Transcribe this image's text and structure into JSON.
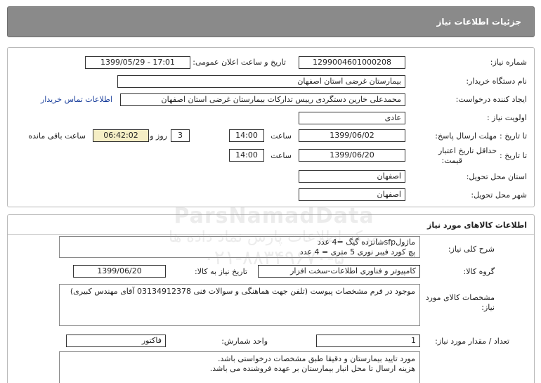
{
  "header": {
    "title": "جزئیات اطلاعات نیاز"
  },
  "info": {
    "need_number_label": "شماره نیاز:",
    "need_number_value": "1299004601000208",
    "announce_label": "تاریخ و ساعت اعلان عمومی:",
    "announce_value": "1399/05/29 - 17:01",
    "buyer_label": "نام دستگاه خریدار:",
    "buyer_value": "بیمارستان غرضی استان اصفهان",
    "requester_label": "ایجاد کننده درخواست:",
    "requester_value": "محمدعلی خارین دستگردی رییس تدارکات بیمارستان غرضی استان اصفهان",
    "contact_link": "اطلاعات تماس خریدار",
    "priority_label": "اولویت نیاز :",
    "priority_value": "عادی",
    "deadline_label": "مهلت ارسال پاسخ:",
    "to_date_label": "تا تاریخ :",
    "deadline_date": "1399/06/02",
    "time_label": "ساعت",
    "deadline_time": "14:00",
    "days_value": "3",
    "days_label": "روز و",
    "remaining_time": "06:42:02",
    "remaining_label": "ساعت باقی مانده",
    "validity_label_1": "حداقل تاریخ اعتبار",
    "validity_label_2": "قیمت:",
    "validity_date": "1399/06/20",
    "validity_time": "14:00",
    "province_label": "استان محل تحویل:",
    "province_value": "اصفهان",
    "city_label": "شهر محل تحویل:",
    "city_value": "اصفهان"
  },
  "goods": {
    "section_title": "اطلاعات کالاهای مورد نیاز",
    "summary_label": "شرح کلی نیاز:",
    "summary_lines": [
      "ماژولsfpشانزده گیگ =4 عدد",
      "پچ کورد فیبر نوری 5 متری = 4 عدد"
    ],
    "group_label": "گروه کالا:",
    "group_value": "کامپیوتر و فناوری اطلاعات-سخت افزار",
    "need_date_label": "تاریخ نیاز به کالا:",
    "need_date_value": "1399/06/20",
    "spec_label_1": "مشخصات کالای مورد",
    "spec_label_2": "نیاز:",
    "spec_text": "موجود در فرم مشخصات پیوست (تلفن جهت هماهنگی و سوالات فنی 03134912378 آقای مهندس کبیری)",
    "qty_label": "تعداد / مقدار مورد نیاز:",
    "qty_value": "1",
    "unit_label": "واحد شمارش:",
    "unit_value": "فاکتور",
    "notes_lines": [
      "مورد تایید بیمارستان و دقیقا طبق مشخصات درخواستی باشد.",
      "هزینه ارسال تا محل انبار بیمارستان بر عهده فروشنده می باشد."
    ]
  },
  "watermark": {
    "line1": "ParsNamadData",
    "line2": "مرکز اطلاعات پارس نماد داده ها",
    "line3": "۰۲۱-۸۸۳۴۹۶۷۰-۵"
  }
}
